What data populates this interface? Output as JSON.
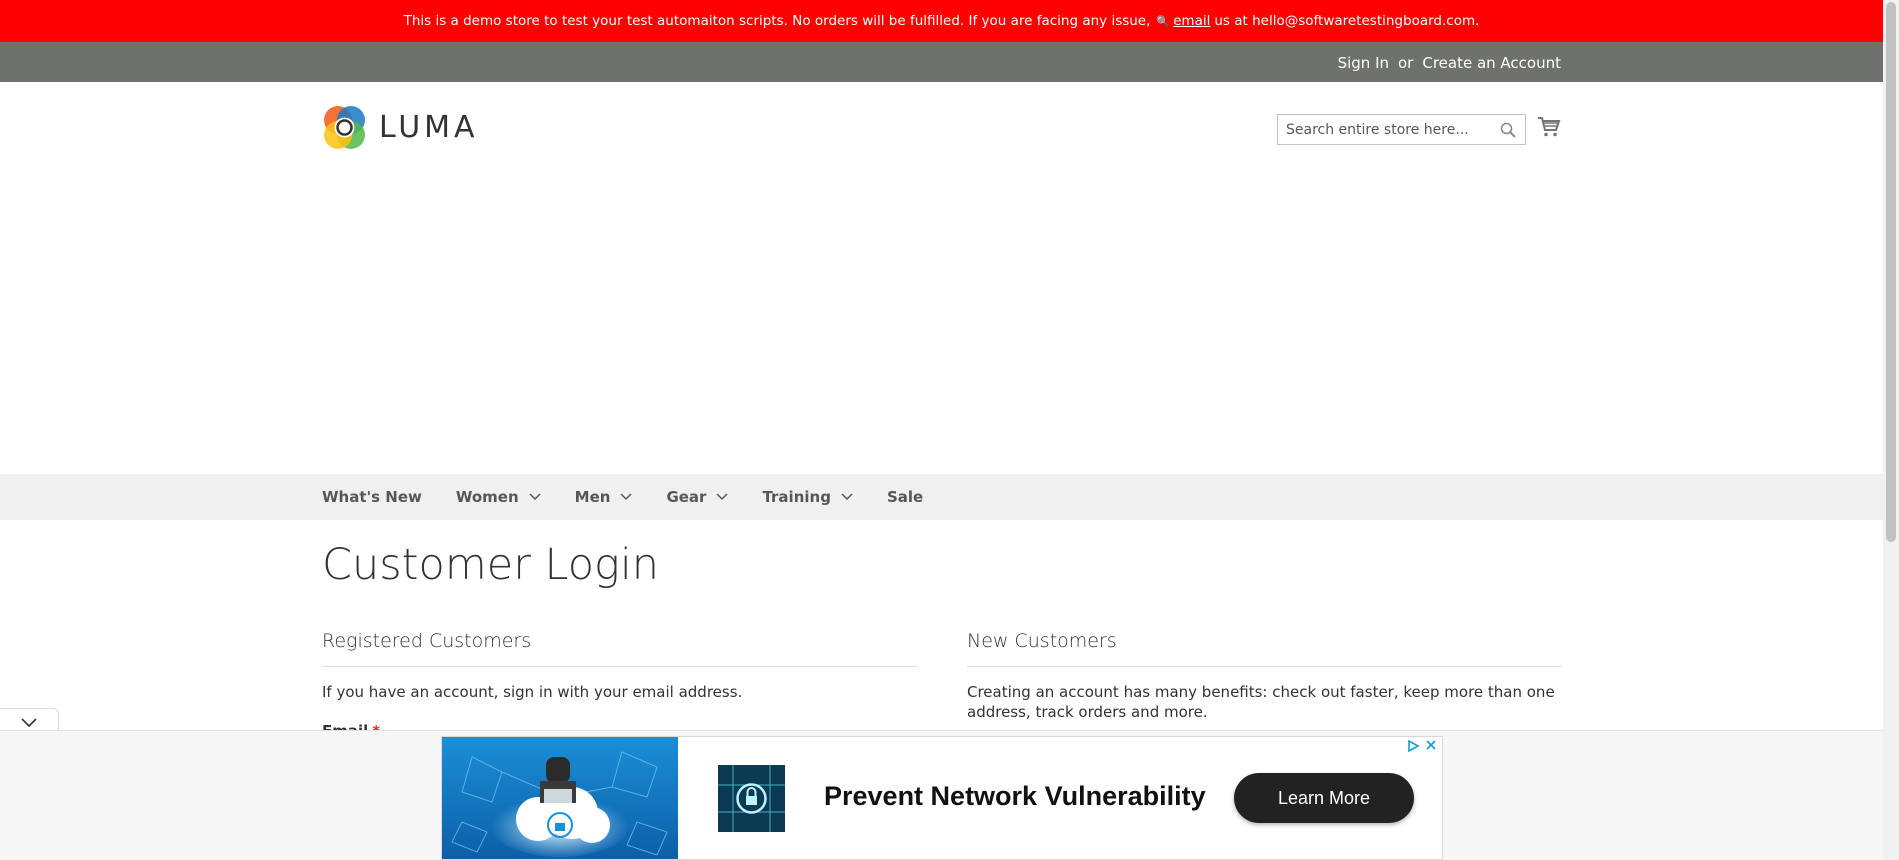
{
  "demo_notice": {
    "text_before": "This is a demo store to test your test automaiton scripts. No orders will be fulfilled. If you are facing any issue,",
    "link": "email",
    "text_after": "us at hello@softwaretestingboard.com."
  },
  "header_links": {
    "sign_in": "Sign In",
    "or": "or",
    "create_account": "Create an Account"
  },
  "logo": {
    "text": "LUMA"
  },
  "search": {
    "placeholder": "Search entire store here..."
  },
  "nav": [
    {
      "label": "What's New",
      "has_dropdown": false
    },
    {
      "label": "Women",
      "has_dropdown": true
    },
    {
      "label": "Men",
      "has_dropdown": true
    },
    {
      "label": "Gear",
      "has_dropdown": true
    },
    {
      "label": "Training",
      "has_dropdown": true
    },
    {
      "label": "Sale",
      "has_dropdown": false
    }
  ],
  "page_title": "Customer Login",
  "registered": {
    "title": "Registered Customers",
    "text": "If you have an account, sign in with your email address.",
    "email_label": "Email",
    "required_mark": "*"
  },
  "new_customers": {
    "title": "New Customers",
    "text": "Creating an account has many benefits: check out faster, keep more than one address, track orders and more."
  },
  "ad": {
    "headline": "Prevent Network Vulnerability",
    "cta": "Learn More"
  },
  "colors": {
    "notice_bg": "#ff0000",
    "header_panel_bg": "#6e716e",
    "nav_bg": "#f0f0f0",
    "required": "#e02b27"
  }
}
